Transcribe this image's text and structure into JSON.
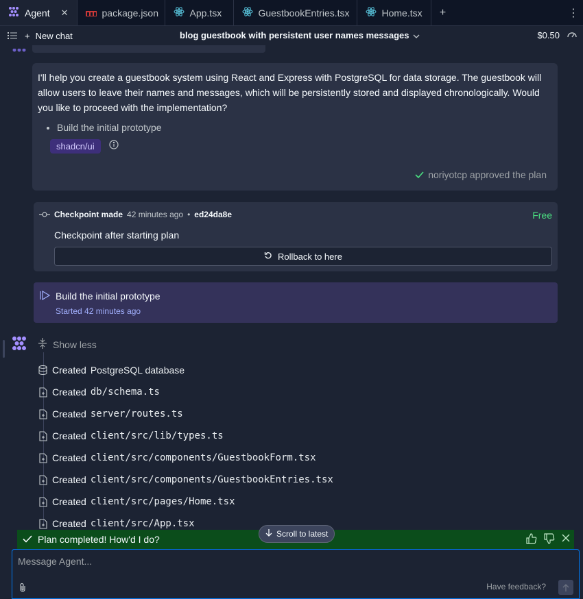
{
  "tabs": [
    {
      "label": "Agent",
      "active": true,
      "icon": "agent-icon"
    },
    {
      "label": "package.json",
      "active": false,
      "icon": "npm-icon"
    },
    {
      "label": "App.tsx",
      "active": false,
      "icon": "react-icon"
    },
    {
      "label": "GuestbookEntries.tsx",
      "active": false,
      "icon": "react-icon"
    },
    {
      "label": "Home.tsx",
      "active": false,
      "icon": "react-icon"
    }
  ],
  "toolbar": {
    "new_chat": "New chat",
    "chat_title": "blog guestbook with persistent user names messages",
    "cost": "$0.50"
  },
  "message": {
    "text": "I'll help you create a guestbook system using React and Express with PostgreSQL for data storage. The guestbook will allow users to leave their names and messages, which will be persistently stored and displayed chronologically. Would you like to proceed with the implementation?",
    "plan_item": "Build the initial prototype",
    "chip": "shadcn/ui",
    "approved": "noriyotcp approved the plan"
  },
  "checkpoint": {
    "label": "Checkpoint made",
    "time": "42 minutes ago",
    "separator": "•",
    "hash": "ed24da8e",
    "price": "Free",
    "description": "Checkpoint after starting plan",
    "rollback": "Rollback to here"
  },
  "plan_step": {
    "title": "Build the initial prototype",
    "status": "Started",
    "time": "42 minutes ago"
  },
  "activity": {
    "show_less": "Show less",
    "items": [
      {
        "verb": "Created",
        "target": "PostgreSQL database",
        "mono": false,
        "icon": "database-icon"
      },
      {
        "verb": "Created",
        "target": "db/schema.ts",
        "mono": true,
        "icon": "file-plus-icon"
      },
      {
        "verb": "Created",
        "target": "server/routes.ts",
        "mono": true,
        "icon": "file-plus-icon"
      },
      {
        "verb": "Created",
        "target": "client/src/lib/types.ts",
        "mono": true,
        "icon": "file-plus-icon"
      },
      {
        "verb": "Created",
        "target": "client/src/components/GuestbookForm.tsx",
        "mono": true,
        "icon": "file-plus-icon"
      },
      {
        "verb": "Created",
        "target": "client/src/components/GuestbookEntries.tsx",
        "mono": true,
        "icon": "file-plus-icon"
      },
      {
        "verb": "Created",
        "target": "client/src/pages/Home.tsx",
        "mono": true,
        "icon": "file-plus-icon"
      },
      {
        "verb": "Created",
        "target": "client/src/App.tsx",
        "mono": true,
        "icon": "file-plus-icon"
      }
    ]
  },
  "feedback": {
    "text": "Plan completed! How'd I do?"
  },
  "scroll_latest": "Scroll to latest",
  "composer": {
    "placeholder": "Message Agent...",
    "feedback_link": "Have feedback?"
  },
  "colors": {
    "accent": "#0079f2",
    "success": "#4ade80",
    "feedback_bg": "#0b4d1b",
    "plan_bg": "#34325a"
  }
}
